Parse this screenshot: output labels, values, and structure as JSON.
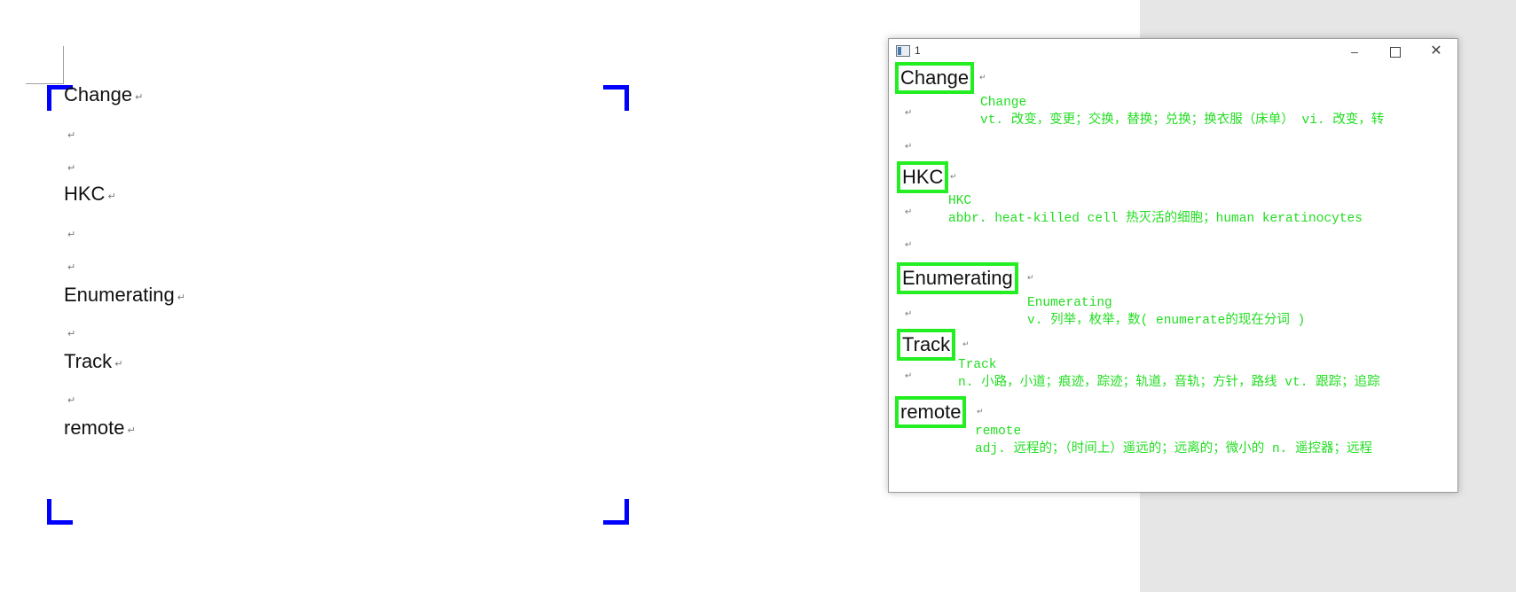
{
  "document": {
    "words": [
      "Change",
      "HKC",
      "Enumerating",
      "Track",
      "remote"
    ],
    "paragraph_mark": "↵"
  },
  "popup": {
    "title": "1",
    "controls": {
      "minimize": "–",
      "maximize": "",
      "close": "✕"
    },
    "entries": [
      {
        "word": "Change",
        "headword": "Change",
        "definition": "vt. 改变，变更；交换，替换；兑换；换衣服（床单） vi. 改变，转"
      },
      {
        "word": "HKC",
        "headword": "HKC",
        "definition": "abbr. heat-killed cell 热灭活的细胞；human keratinocytes"
      },
      {
        "word": "Enumerating",
        "headword": "Enumerating",
        "definition": "v. 列举，枚举，数( enumerate的现在分词 )"
      },
      {
        "word": "Track",
        "headword": "Track",
        "definition": "n. 小路，小道；痕迹，踪迹；轨道，音轨；方针，路线 vt. 跟踪；追踪"
      },
      {
        "word": "remote",
        "headword": "remote",
        "definition": "adj. 远程的；（时间上）遥远的；远离的；微小的 n. 遥控器；远程"
      }
    ]
  },
  "colors": {
    "highlight": "#22ee22",
    "definition_text": "#22dd22",
    "crop_marks": "#0000ff"
  }
}
